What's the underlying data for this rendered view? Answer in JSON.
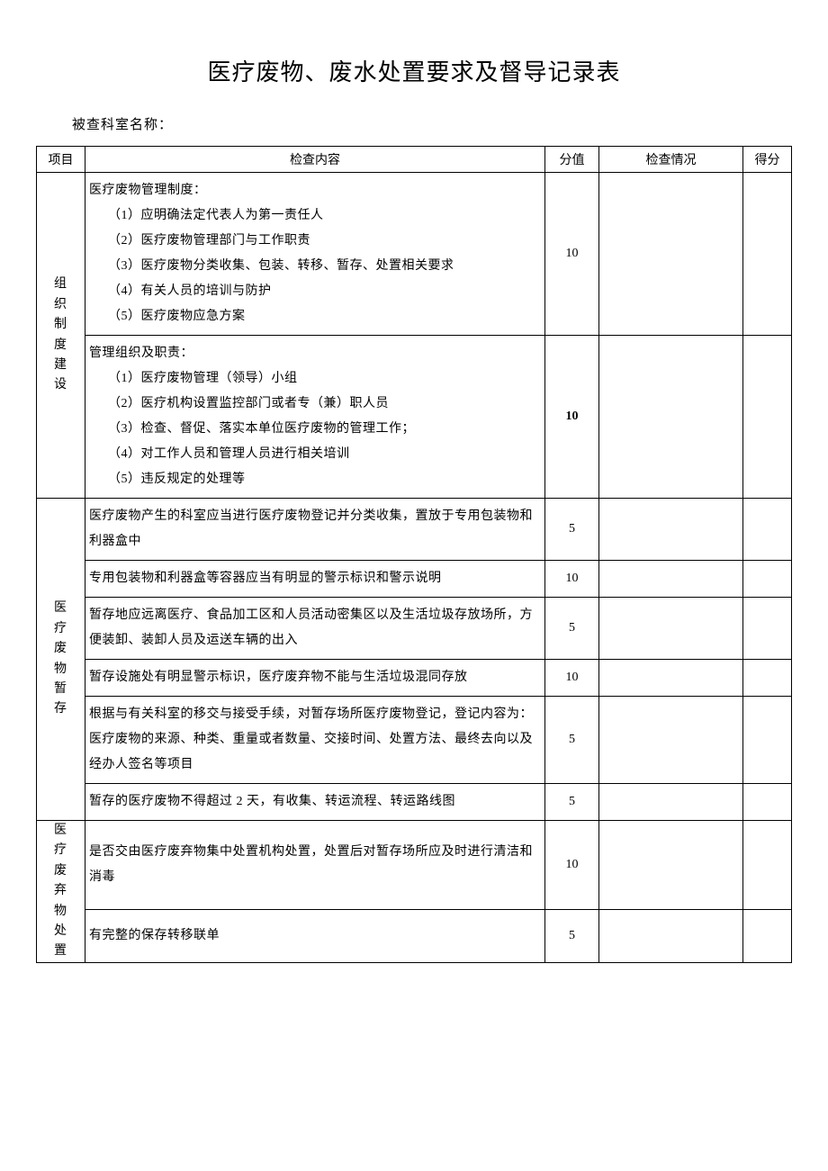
{
  "title": "医疗废物、废水处置要求及督导记录表",
  "dept_label": "被查科室名称：",
  "headers": {
    "project": "项目",
    "content": "检查内容",
    "score": "分值",
    "status": "检查情况",
    "got": "得分"
  },
  "groups": [
    {
      "label": "组织制度建设",
      "rows": [
        {
          "lines": [
            "医疗废物管理制度：",
            "（1）应明确法定代表人为第一责任人",
            "（2）医疗废物管理部门与工作职责",
            "（3）医疗废物分类收集、包装、转移、暂存、处置相关要求",
            "（4）有关人员的培训与防护",
            "（5）医疗废物应急方案"
          ],
          "subFrom": 1,
          "score": "10"
        },
        {
          "lines": [
            "管理组织及职责：",
            "（1）医疗废物管理（领导）小组",
            "（2）医疗机构设置监控部门或者专（兼）职人员",
            "（3）检查、督促、落实本单位医疗废物的管理工作；",
            "（4）对工作人员和管理人员进行相关培训",
            "（5）违反规定的处理等"
          ],
          "subFrom": 1,
          "score": "10",
          "bold": true
        }
      ]
    },
    {
      "label": "医疗废物暂存",
      "rows": [
        {
          "lines": [
            "医疗废物产生的科室应当进行医疗废物登记并分类收集，置放于专用包装物和利器盒中"
          ],
          "score": "5",
          "tall": true
        },
        {
          "lines": [
            "专用包装物和利器盒等容器应当有明显的警示标识和警示说明"
          ],
          "score": "10",
          "tall": true
        },
        {
          "lines": [
            "暂存地应远离医疗、食品加工区和人员活动密集区以及生活垃圾存放场所，方便装卸、装卸人员及运送车辆的出入"
          ],
          "score": "5",
          "tall": true
        },
        {
          "lines": [
            "暂存设施处有明显警示标识，医疗废弃物不能与生活垃圾混同存放"
          ],
          "score": "10",
          "tall": true
        },
        {
          "lines": [
            "根据与有关科室的移交与接受手续，对暂存场所医疗废物登记，登记内容为：医疗废物的来源、种类、重量或者数量、交接时间、处置方法、最终去向以及经办人签名等项目"
          ],
          "score": "5"
        },
        {
          "lines": [
            "暂存的医疗废物不得超过 2 天，有收集、转运流程、转运路线图"
          ],
          "score": "5",
          "tall": true
        }
      ]
    },
    {
      "label": "医疗废弃物处置",
      "rows": [
        {
          "lines": [
            "是否交由医疗废弃物集中处置机构处置，处置后对暂存场所应及时进行清洁和消毒"
          ],
          "score": "10",
          "tall": true
        },
        {
          "lines": [
            "有完整的保存转移联单"
          ],
          "score": "5",
          "tall": true
        }
      ]
    }
  ]
}
